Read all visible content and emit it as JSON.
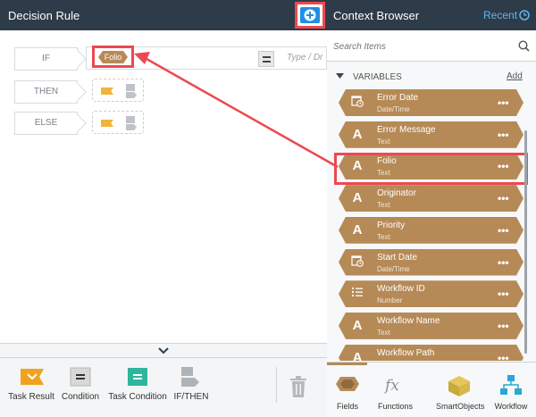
{
  "left_panel": {
    "title": "Decision Rule",
    "add_button_icon": "add-icon",
    "rules": {
      "if_label": "IF",
      "then_label": "THEN",
      "else_label": "ELSE",
      "if_token": "Folio",
      "operator_icon": "equals-icon",
      "value_placeholder": "Type / Dr"
    },
    "collapse_icon": "chevron-down-icon",
    "toolbar": {
      "items": [
        {
          "label": "Task Result",
          "icon": "task-result-icon"
        },
        {
          "label": "Condition",
          "icon": "condition-icon"
        },
        {
          "label": "Task Condition",
          "icon": "task-condition-icon"
        },
        {
          "label": "IF/THEN",
          "icon": "if-then-icon"
        }
      ],
      "delete_icon": "trash-icon"
    }
  },
  "right_panel": {
    "title": "Context Browser",
    "recent_label": "Recent",
    "recent_icon": "clock-icon",
    "search": {
      "placeholder": "Search Items",
      "icon": "search-icon"
    },
    "section": {
      "title": "VARIABLES",
      "add_label": "Add"
    },
    "variables": [
      {
        "name": "Error Date",
        "type": "Date/Time",
        "icon": "calendar-clock-icon"
      },
      {
        "name": "Error Message",
        "type": "Text",
        "icon": "text-icon"
      },
      {
        "name": "Folio",
        "type": "Text",
        "icon": "text-icon"
      },
      {
        "name": "Originator",
        "type": "Text",
        "icon": "text-icon"
      },
      {
        "name": "Priority",
        "type": "Text",
        "icon": "text-icon"
      },
      {
        "name": "Start Date",
        "type": "Date/Time",
        "icon": "calendar-clock-icon"
      },
      {
        "name": "Workflow ID",
        "type": "Number",
        "icon": "number-list-icon"
      },
      {
        "name": "Workflow Name",
        "type": "Text",
        "icon": "text-icon"
      },
      {
        "name": "Workflow Path",
        "type": "",
        "icon": "text-icon"
      }
    ],
    "more_label": "•••",
    "tabs": [
      {
        "label": "Fields",
        "icon": "fields-icon"
      },
      {
        "label": "Functions",
        "icon": "fx-icon"
      },
      {
        "label": "SmartObjects",
        "icon": "cube-icon"
      },
      {
        "label": "Workflow",
        "icon": "workflow-icon"
      }
    ]
  },
  "colors": {
    "header": "#2e3b48",
    "token": "#b68a56",
    "highlight": "#ec4950",
    "accent_blue": "#1f8fe6"
  }
}
